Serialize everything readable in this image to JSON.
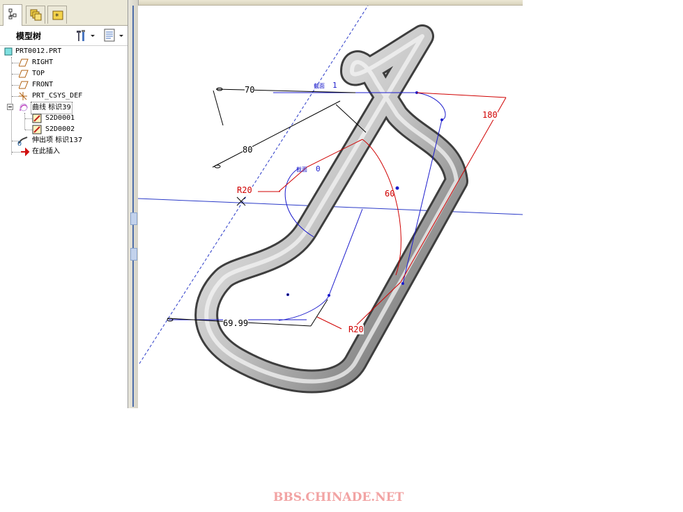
{
  "panel": {
    "title": "模型树",
    "tabs": [
      "model-tree-tab",
      "layers-tab",
      "favorites-tab"
    ]
  },
  "tree": {
    "items": [
      {
        "label": "PRT0012.PRT",
        "icon": "part-icon"
      },
      {
        "label": "RIGHT",
        "icon": "datum-plane-icon"
      },
      {
        "label": "TOP",
        "icon": "datum-plane-icon"
      },
      {
        "label": "FRONT",
        "icon": "datum-plane-icon"
      },
      {
        "label": "PRT_CSYS_DEF",
        "icon": "csys-icon"
      },
      {
        "label": "曲线 标识39",
        "icon": "curve-icon"
      },
      {
        "label": "S2D0001",
        "icon": "sketch-icon"
      },
      {
        "label": "S2D0002",
        "icon": "sketch-icon"
      },
      {
        "label": "伸出项 标识137",
        "icon": "sweep-icon"
      },
      {
        "label": "在此插入",
        "icon": "insert-here-arrow-icon"
      }
    ]
  },
  "viewport": {
    "dims": {
      "d70": "70",
      "d80": "80",
      "d180": "180",
      "d60": "60",
      "d6999": "69.99",
      "r20_left": "R20",
      "r20_bottom": "R20"
    },
    "plane_tags": {
      "tag1": "截面",
      "tag1_num": "1",
      "tag0": "截面",
      "tag0_num": "0"
    },
    "colors": {
      "dimension": "#d00000",
      "sketch": "#1a1acc",
      "datum": "#2030c0",
      "dim_black": "#000000"
    }
  },
  "watermark": "BBS.CHINADE.NET"
}
